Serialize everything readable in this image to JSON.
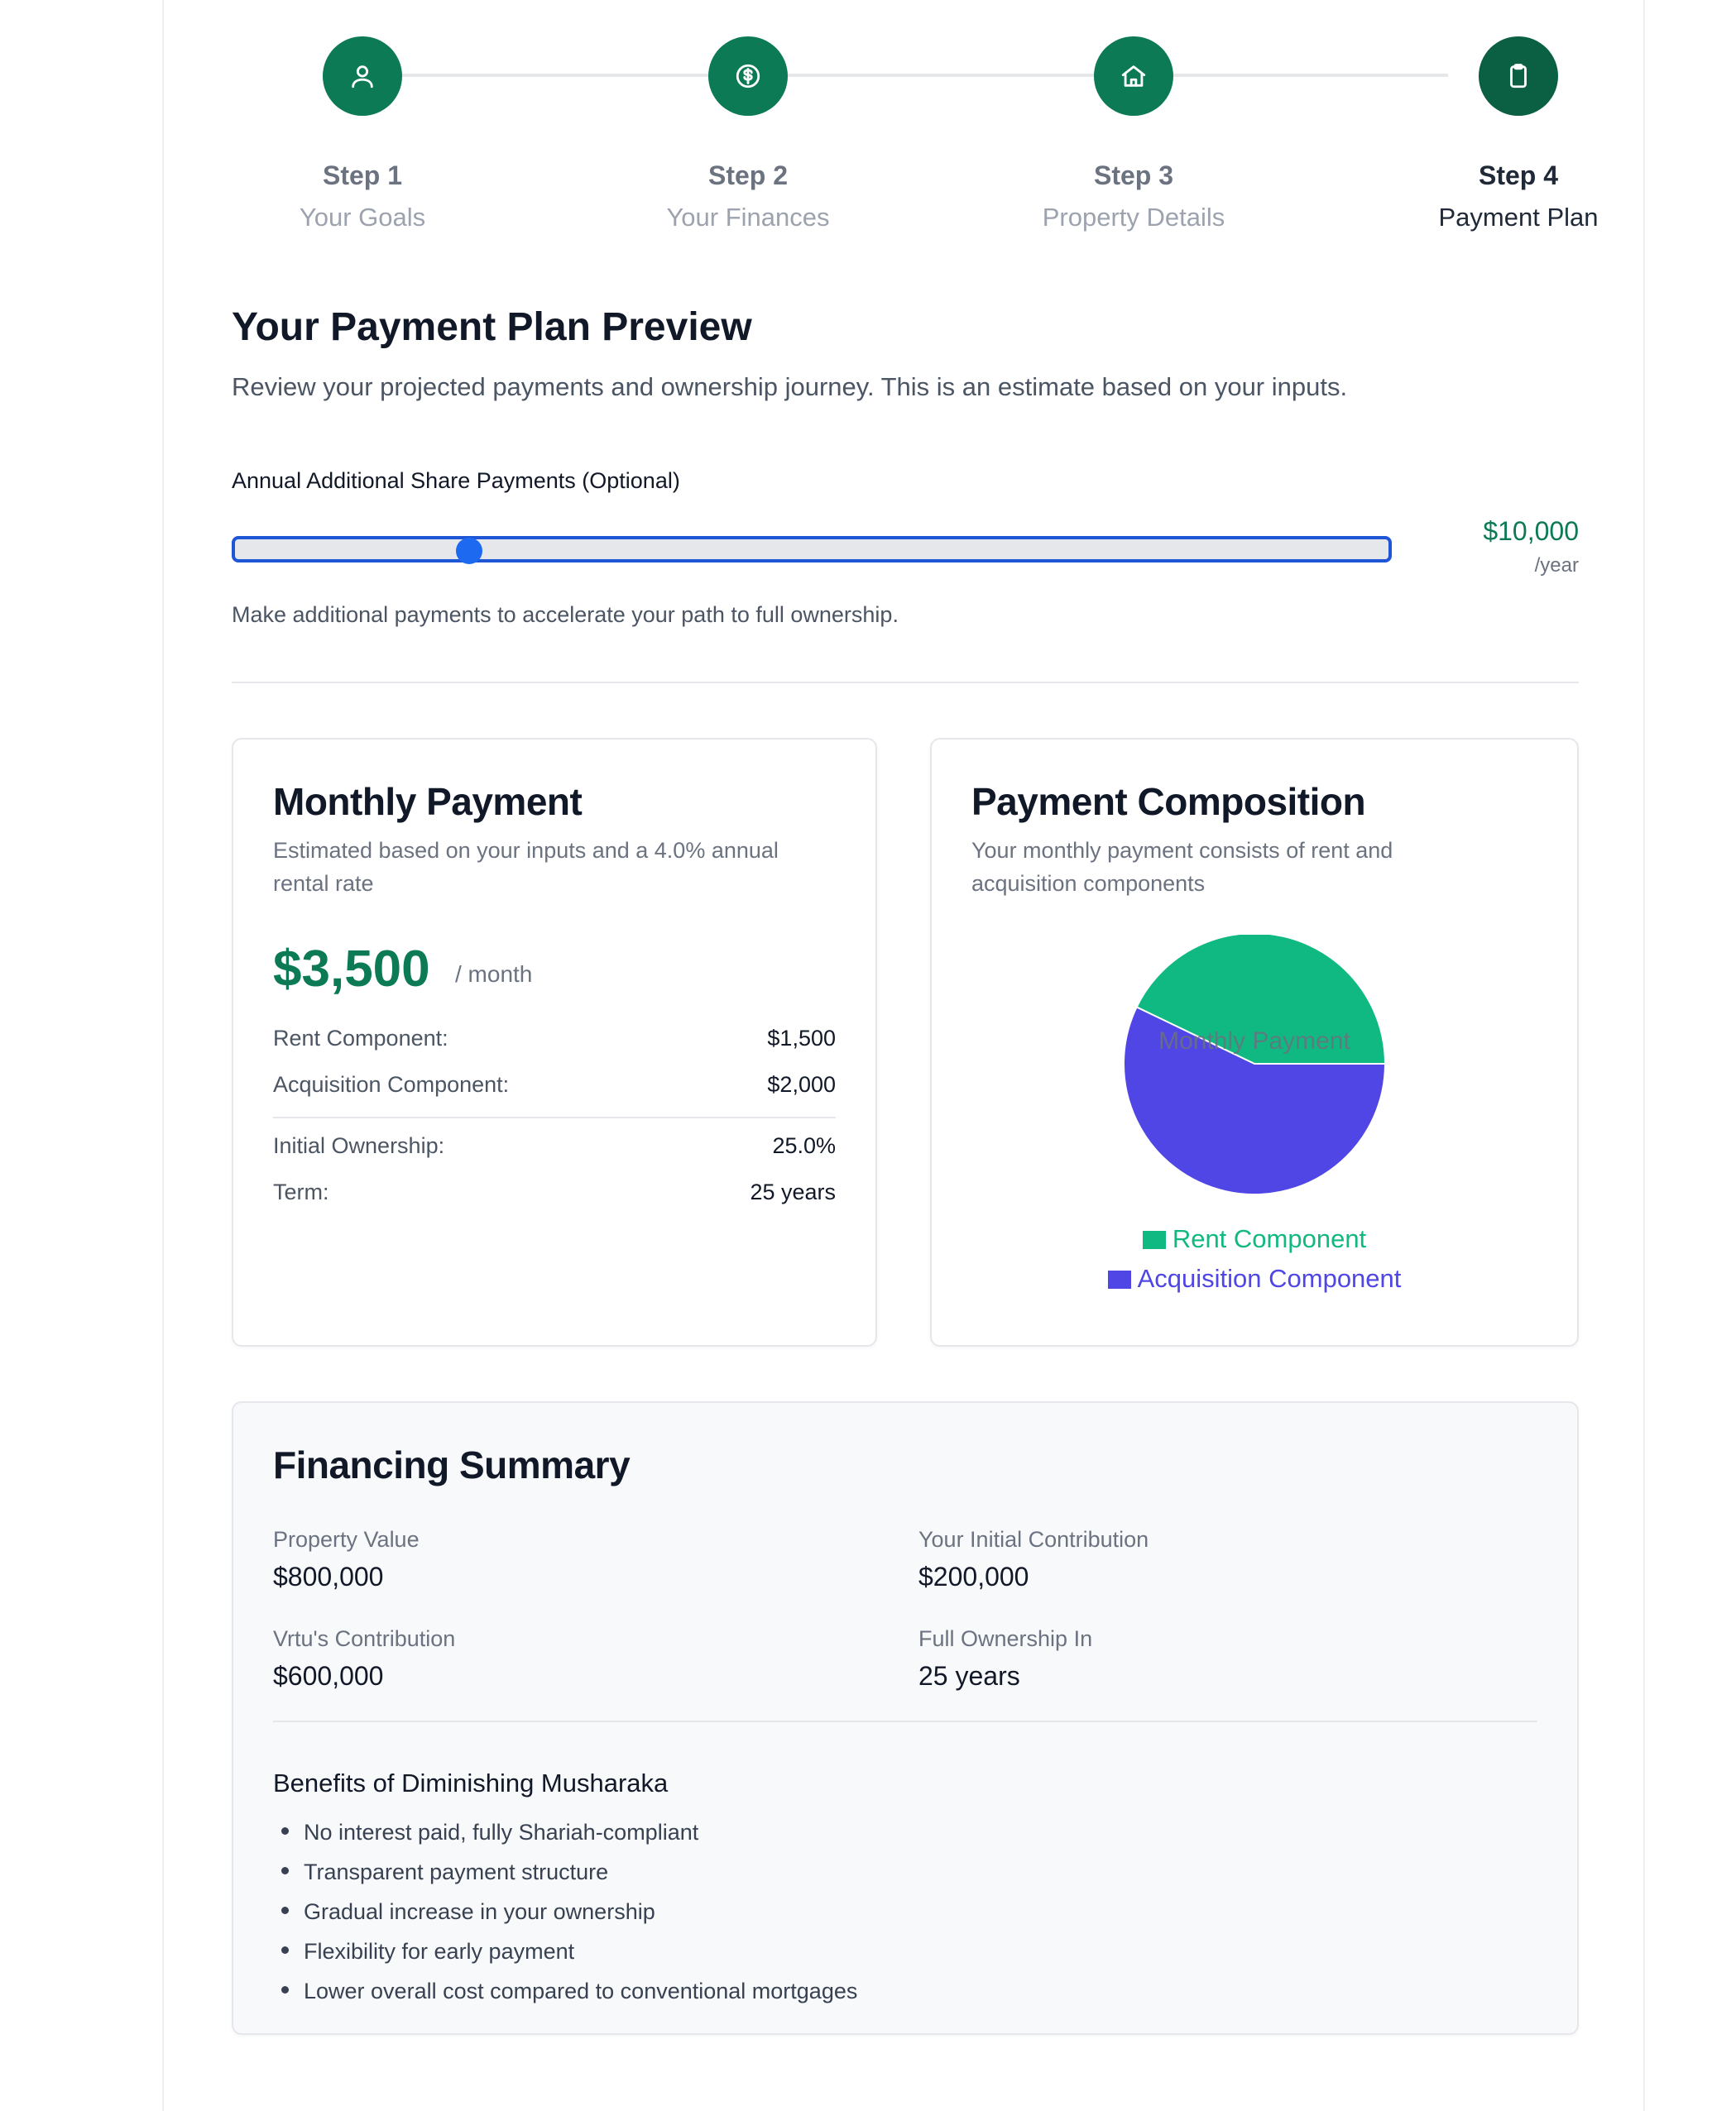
{
  "stepper": {
    "steps": [
      {
        "title": "Step 1",
        "subtitle": "Your Goals",
        "icon": "user-icon"
      },
      {
        "title": "Step 2",
        "subtitle": "Your Finances",
        "icon": "dollar-icon"
      },
      {
        "title": "Step 3",
        "subtitle": "Property Details",
        "icon": "home-icon"
      },
      {
        "title": "Step 4",
        "subtitle": "Payment Plan",
        "icon": "clipboard-icon"
      }
    ],
    "current_step": 4,
    "accent_color": "#0b7a55"
  },
  "header": {
    "title": "Your Payment Plan Preview",
    "description": "Review your projected payments and ownership journey. This is an estimate based on your inputs."
  },
  "slider": {
    "label": "Annual Additional Share Payments (Optional)",
    "value": "$10,000",
    "unit": "/year",
    "help": "Make additional payments to accelerate your path to full ownership.",
    "position_fraction": 0.2
  },
  "monthly_payment": {
    "title": "Monthly Payment",
    "description": "Estimated based on your inputs and a 4.0% annual rental rate",
    "amount": "$3,500",
    "per": "/ month",
    "rows": [
      {
        "label": "Rent Component:",
        "value": "$1,500"
      },
      {
        "label": "Acquisition Component:",
        "value": "$2,000"
      },
      {
        "label": "Initial Ownership:",
        "value": "25.0%"
      },
      {
        "label": "Term:",
        "value": "25 years"
      }
    ]
  },
  "composition": {
    "title": "Payment Composition",
    "description": "Your monthly payment consists of rent and acquisition components",
    "chart_center_label": "Monthly Payment"
  },
  "chart_data": {
    "type": "pie",
    "title": "Monthly Payment",
    "categories": [
      "Rent Component",
      "Acquisition Component"
    ],
    "values": [
      1500,
      2000
    ],
    "colors": [
      "#10b981",
      "#4f46e5"
    ],
    "legend_position": "bottom"
  },
  "financing": {
    "title": "Financing Summary",
    "items": [
      {
        "label": "Property Value",
        "value": "$800,000"
      },
      {
        "label": "Your Initial Contribution",
        "value": "$200,000"
      },
      {
        "label": "Vrtu's Contribution",
        "value": "$600,000"
      },
      {
        "label": "Full Ownership In",
        "value": "25 years"
      }
    ],
    "benefits_title": "Benefits of Diminishing Musharaka",
    "benefits": [
      "No interest paid, fully Shariah-compliant",
      "Transparent payment structure",
      "Gradual increase in your ownership",
      "Flexibility for early payment",
      "Lower overall cost compared to conventional mortgages"
    ]
  }
}
